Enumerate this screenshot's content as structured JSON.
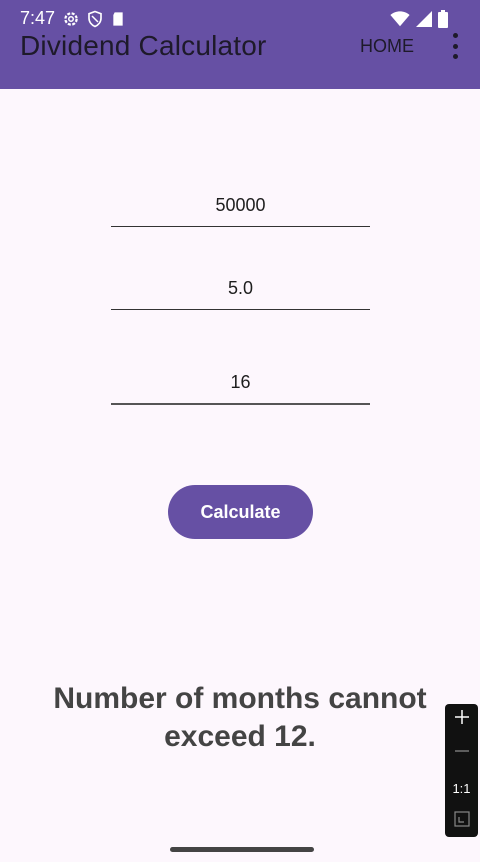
{
  "status": {
    "time": "7:47"
  },
  "header": {
    "title": "Dividend Calculator",
    "home_label": "HOME"
  },
  "inputs": {
    "amount": "50000",
    "rate": "5.0",
    "months": "16"
  },
  "calculate_label": "Calculate",
  "result_text": "Number of months cannot exceed 12.",
  "zoom": {
    "ratio_label": "1:1"
  },
  "colors": {
    "appbar": "#6650a4",
    "button": "#6650a4",
    "background": "#fdf7fd"
  }
}
